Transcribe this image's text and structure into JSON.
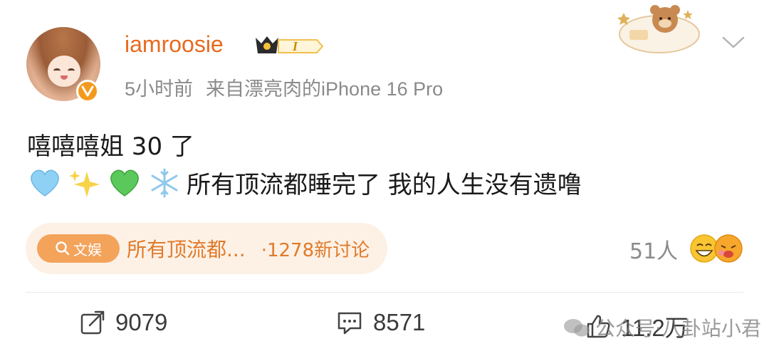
{
  "post": {
    "username": "iamroosie",
    "vip_level": "I",
    "time": "5小时前",
    "source": "来自漂亮肉的iPhone 16 Pro",
    "line1": "嘻嘻嘻姐 30 了",
    "line2_text": "所有顶流都睡完了 我的人生没有遗噜",
    "emojis": [
      "light-blue-heart",
      "sparkles",
      "green-heart",
      "snowflake"
    ]
  },
  "topic": {
    "tag": "文娱",
    "title": "所有顶流都...",
    "count": "·1278新讨论"
  },
  "reactions": {
    "count": "51人"
  },
  "actions": {
    "repost": "9079",
    "comment": "8571",
    "like": "11.2万"
  },
  "watermark": {
    "text": "公众号·八卦站小君"
  },
  "colors": {
    "username": "#e86a1d",
    "meta": "#8a8a8a",
    "pill_bg": "#fdf1e6",
    "pill_text": "#e07a2a"
  }
}
